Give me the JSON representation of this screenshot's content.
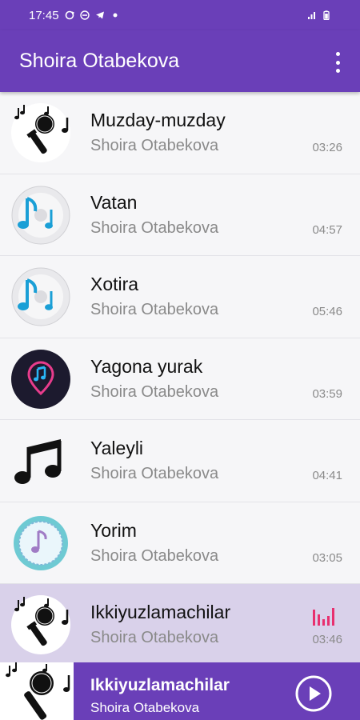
{
  "status_bar": {
    "time": "17:45"
  },
  "app_bar": {
    "title": "Shoira Otabekova"
  },
  "songs": [
    {
      "title": "Muzday-muzday",
      "artist": "Shoira Otabekova",
      "duration": "03:26",
      "art": "microphone-notes-icon"
    },
    {
      "title": "Vatan",
      "artist": "Shoira Otabekova",
      "duration": "04:57",
      "art": "cd-music-note-icon"
    },
    {
      "title": "Xotira",
      "artist": "Shoira Otabekova",
      "duration": "05:46",
      "art": "cd-music-note-icon"
    },
    {
      "title": "Yagona yurak",
      "artist": "Shoira Otabekova",
      "duration": "03:59",
      "art": "pin-music-note-icon"
    },
    {
      "title": "Yaleyli",
      "artist": "Shoira Otabekova",
      "duration": "04:41",
      "art": "beamed-notes-icon"
    },
    {
      "title": "Yorim",
      "artist": "Shoira Otabekova",
      "duration": "03:05",
      "art": "badge-music-note-icon"
    },
    {
      "title": "Ikkiyuzlamachilar",
      "artist": "Shoira Otabekova",
      "duration": "03:46",
      "art": "microphone-notes-icon",
      "playing": true
    }
  ],
  "now_playing": {
    "title": "Ikkiyuzlamachilar",
    "artist": "Shoira Otabekova"
  },
  "colors": {
    "primary": "#6a3fb8",
    "active_row": "#d9d1ea",
    "equalizer": "#e8306f"
  }
}
